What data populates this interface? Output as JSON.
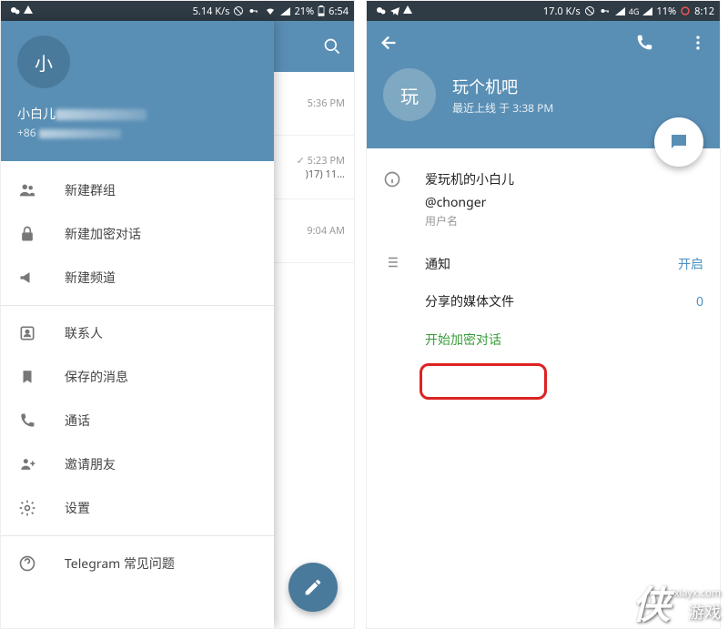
{
  "status_left": {
    "speed": "5.14 K/s",
    "battery": "21%",
    "time": "6:54"
  },
  "status_right": {
    "speed": "17.0 K/s",
    "net": "4G",
    "battery": "11%",
    "time": "8:12"
  },
  "drawer": {
    "avatar_char": "小",
    "name": "小白儿",
    "phone_prefix": "+86",
    "menu": [
      {
        "icon": "group",
        "label": "新建群组"
      },
      {
        "icon": "lock",
        "label": "新建加密对话"
      },
      {
        "icon": "megaphone",
        "label": "新建频道"
      },
      {
        "icon": "contacts",
        "label": "联系人"
      },
      {
        "icon": "bookmark",
        "label": "保存的消息"
      },
      {
        "icon": "phone",
        "label": "通话"
      },
      {
        "icon": "invite",
        "label": "邀请朋友"
      },
      {
        "icon": "settings",
        "label": "设置"
      },
      {
        "icon": "help",
        "label": "Telegram 常见问题"
      }
    ]
  },
  "chat_bg": {
    "times": [
      "5:36 PM",
      "5:23 PM",
      "9:04 AM"
    ],
    "snippet": ")17) 11..."
  },
  "profile": {
    "avatar_char": "玩",
    "title": "玩个机吧",
    "subtitle": "最近上线 于 3:38 PM",
    "bio": "爱玩机的小白儿",
    "username": "@chonger",
    "username_label": "用户名",
    "notify_label": "通知",
    "notify_value": "开启",
    "media_label": "分享的媒体文件",
    "media_value": "0",
    "encrypt_label": "开始加密对话"
  },
  "watermark": {
    "big": "侠",
    "url": "xiayx.com",
    "cn": "游戏"
  }
}
